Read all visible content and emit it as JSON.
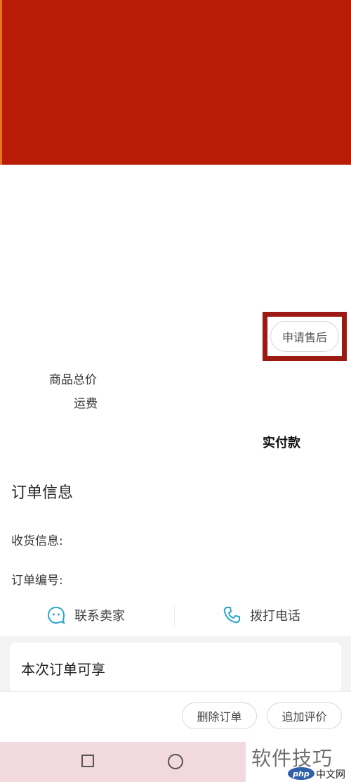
{
  "order": {
    "aftersale_button": "申请售后",
    "goods_total_label": "商品总价",
    "shipping_label": "运费",
    "paid_label": "实付款"
  },
  "order_info": {
    "title": "订单信息",
    "receive_info_label": "收货信息:",
    "order_number_label": "订单编号:"
  },
  "contact": {
    "seller_label": "联系卖家",
    "call_label": "拨打电话"
  },
  "privileges": {
    "title": "本次订单可享"
  },
  "actions": {
    "delete_label": "删除订单",
    "review_label": "追加评价"
  },
  "watermark": {
    "text": "软件技巧",
    "logo": "php",
    "site": "中文网"
  },
  "colors": {
    "banner": "#b81c07",
    "highlight_border": "#9c1a13"
  },
  "icons": [
    "smiley-chat-icon",
    "phone-icon",
    "nav-recent-icon",
    "nav-home-icon"
  ]
}
